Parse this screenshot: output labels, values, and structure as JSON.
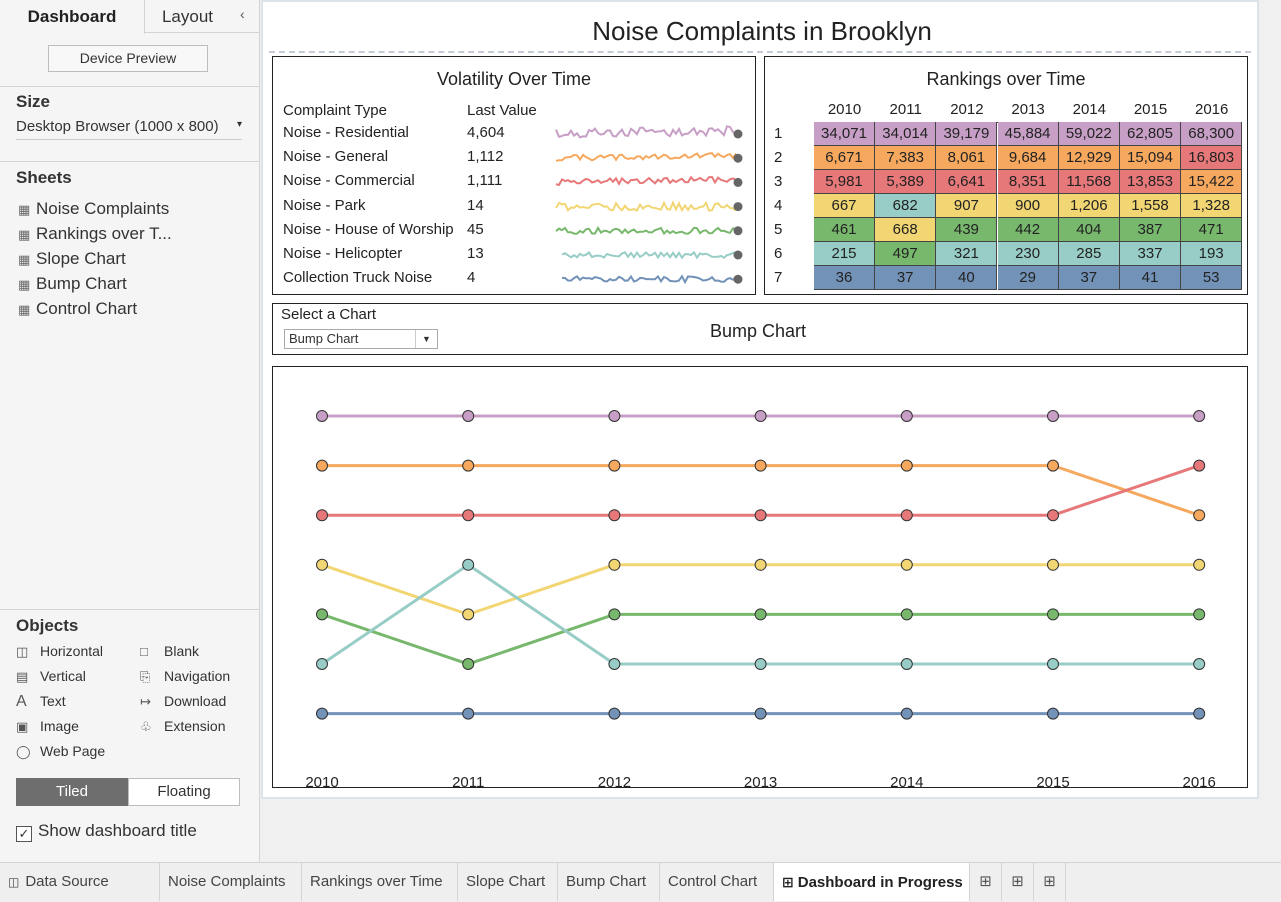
{
  "left_panel": {
    "tabs": {
      "dashboard": "Dashboard",
      "layout": "Layout"
    },
    "collapse_icon": "chevron-left-icon",
    "device_preview": "Device Preview",
    "size": {
      "title": "Size",
      "value": "Desktop Browser (1000 x 800)"
    },
    "sheets": {
      "title": "Sheets",
      "items": [
        "Noise Complaints",
        "Rankings over T...",
        "Slope Chart",
        "Bump Chart",
        "Control Chart"
      ]
    },
    "objects": {
      "title": "Objects",
      "items": [
        "Horizontal",
        "Blank",
        "Vertical",
        "Navigation",
        "Text",
        "Download",
        "Image",
        "Extension",
        "Web Page"
      ]
    },
    "tiled": "Tiled",
    "floating": "Floating",
    "show_title": "Show dashboard title"
  },
  "dashboard": {
    "title": "Noise Complaints in Brooklyn",
    "volatility": {
      "title": "Volatility Over Time",
      "col_type": "Complaint Type",
      "col_last": "Last Value",
      "rows": [
        {
          "type": "Noise - Residential",
          "last": "4,604",
          "color": "#c79fc6"
        },
        {
          "type": "Noise - General",
          "last": "1,112",
          "color": "#f5a85e"
        },
        {
          "type": "Noise - Commercial",
          "last": "1,111",
          "color": "#e6787a"
        },
        {
          "type": "Noise - Park",
          "last": "14",
          "color": "#f1d673"
        },
        {
          "type": "Noise - House of Worship",
          "last": "45",
          "color": "#78b86d"
        },
        {
          "type": "Noise - Helicopter",
          "last": "13",
          "color": "#97cdc6"
        },
        {
          "type": "Collection Truck Noise",
          "last": "4",
          "color": "#7292b7"
        }
      ]
    },
    "rankings": {
      "title": "Rankings over Time",
      "years": [
        "2010",
        "2011",
        "2012",
        "2013",
        "2014",
        "2015",
        "2016"
      ],
      "ranks": [
        "1",
        "2",
        "3",
        "4",
        "5",
        "6",
        "7"
      ],
      "cells": [
        [
          "34,071",
          "34,014",
          "39,179",
          "45,884",
          "59,022",
          "62,805",
          "68,300"
        ],
        [
          "6,671",
          "7,383",
          "8,061",
          "9,684",
          "12,929",
          "15,094",
          "16,803"
        ],
        [
          "5,981",
          "5,389",
          "6,641",
          "8,351",
          "11,568",
          "13,853",
          "15,422"
        ],
        [
          "667",
          "682",
          "907",
          "900",
          "1,206",
          "1,558",
          "1,328"
        ],
        [
          "461",
          "668",
          "439",
          "442",
          "404",
          "387",
          "471"
        ],
        [
          "215",
          "497",
          "321",
          "230",
          "285",
          "337",
          "193"
        ],
        [
          "36",
          "37",
          "40",
          "29",
          "37",
          "41",
          "53"
        ]
      ],
      "cell_colors": [
        [
          "#c79fc6",
          "#c79fc6",
          "#c79fc6",
          "#c79fc6",
          "#c79fc6",
          "#c79fc6",
          "#c79fc6"
        ],
        [
          "#f5a85e",
          "#f5a85e",
          "#f5a85e",
          "#f5a85e",
          "#f5a85e",
          "#f5a85e",
          "#e6787a"
        ],
        [
          "#e6787a",
          "#e6787a",
          "#e6787a",
          "#e6787a",
          "#e6787a",
          "#e6787a",
          "#f5a85e"
        ],
        [
          "#f1d673",
          "#97cdc6",
          "#f1d673",
          "#f1d673",
          "#f1d673",
          "#f1d673",
          "#f1d673"
        ],
        [
          "#78b86d",
          "#f1d673",
          "#78b86d",
          "#78b86d",
          "#78b86d",
          "#78b86d",
          "#78b86d"
        ],
        [
          "#97cdc6",
          "#78b86d",
          "#97cdc6",
          "#97cdc6",
          "#97cdc6",
          "#97cdc6",
          "#97cdc6"
        ],
        [
          "#7292b7",
          "#7292b7",
          "#7292b7",
          "#7292b7",
          "#7292b7",
          "#7292b7",
          "#7292b7"
        ]
      ]
    },
    "selector": {
      "label": "Select a Chart",
      "value": "Bump Chart"
    },
    "bump_title": "Bump Chart"
  },
  "chart_data": {
    "type": "line",
    "title": "Bump Chart",
    "x": [
      "2010",
      "2011",
      "2012",
      "2013",
      "2014",
      "2015",
      "2016"
    ],
    "y_reversed": true,
    "ylim": [
      1,
      7
    ],
    "series": [
      {
        "color": "#c79fc6",
        "ranks": [
          1,
          1,
          1,
          1,
          1,
          1,
          1
        ]
      },
      {
        "color": "#f5a85e",
        "ranks": [
          2,
          2,
          2,
          2,
          2,
          2,
          3
        ]
      },
      {
        "color": "#e6787a",
        "ranks": [
          3,
          3,
          3,
          3,
          3,
          3,
          2
        ]
      },
      {
        "color": "#f1d673",
        "ranks": [
          4,
          5,
          4,
          4,
          4,
          4,
          4
        ]
      },
      {
        "color": "#78b86d",
        "ranks": [
          5,
          6,
          5,
          5,
          5,
          5,
          5
        ]
      },
      {
        "color": "#97cdc6",
        "ranks": [
          6,
          4,
          6,
          6,
          6,
          6,
          6
        ]
      },
      {
        "color": "#7292b7",
        "ranks": [
          7,
          7,
          7,
          7,
          7,
          7,
          7
        ]
      }
    ]
  },
  "bottom_tabs": {
    "items": [
      "Data Source",
      "Noise Complaints",
      "Rankings over Time",
      "Slope Chart",
      "Bump Chart",
      "Control Chart",
      "Dashboard in Progress"
    ],
    "icons": [
      "new-worksheet-icon",
      "new-dashboard-icon",
      "new-story-icon"
    ]
  }
}
